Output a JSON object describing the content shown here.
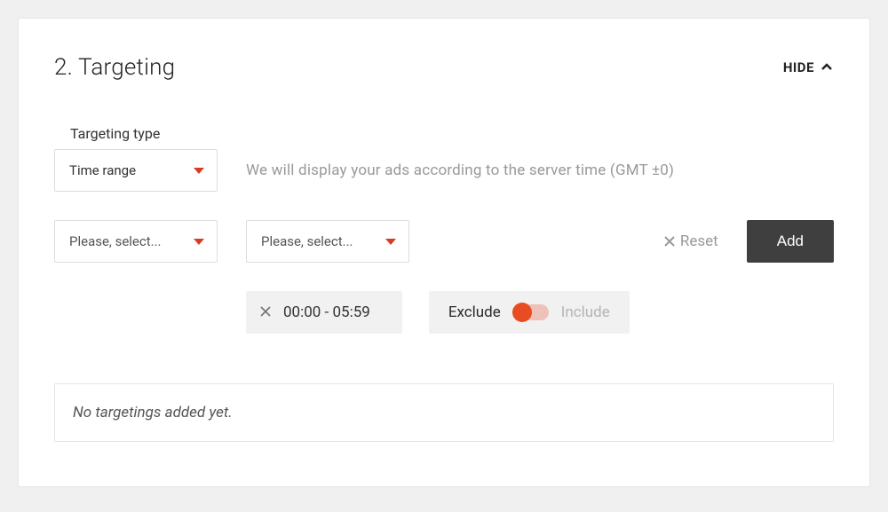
{
  "section": {
    "title": "2. Targeting",
    "hide_label": "HIDE"
  },
  "targeting_type": {
    "label": "Targeting type",
    "selected": "Time range",
    "helper": "We will display your ads according to the server time (GMT ±0)"
  },
  "selectors": {
    "from_placeholder": "Please, select...",
    "to_placeholder": "Please, select..."
  },
  "actions": {
    "reset": "Reset",
    "add": "Add"
  },
  "chip": {
    "time_range": "00:00 - 05:59",
    "exclude": "Exclude",
    "include": "Include"
  },
  "empty": {
    "message": "No targetings added yet."
  }
}
